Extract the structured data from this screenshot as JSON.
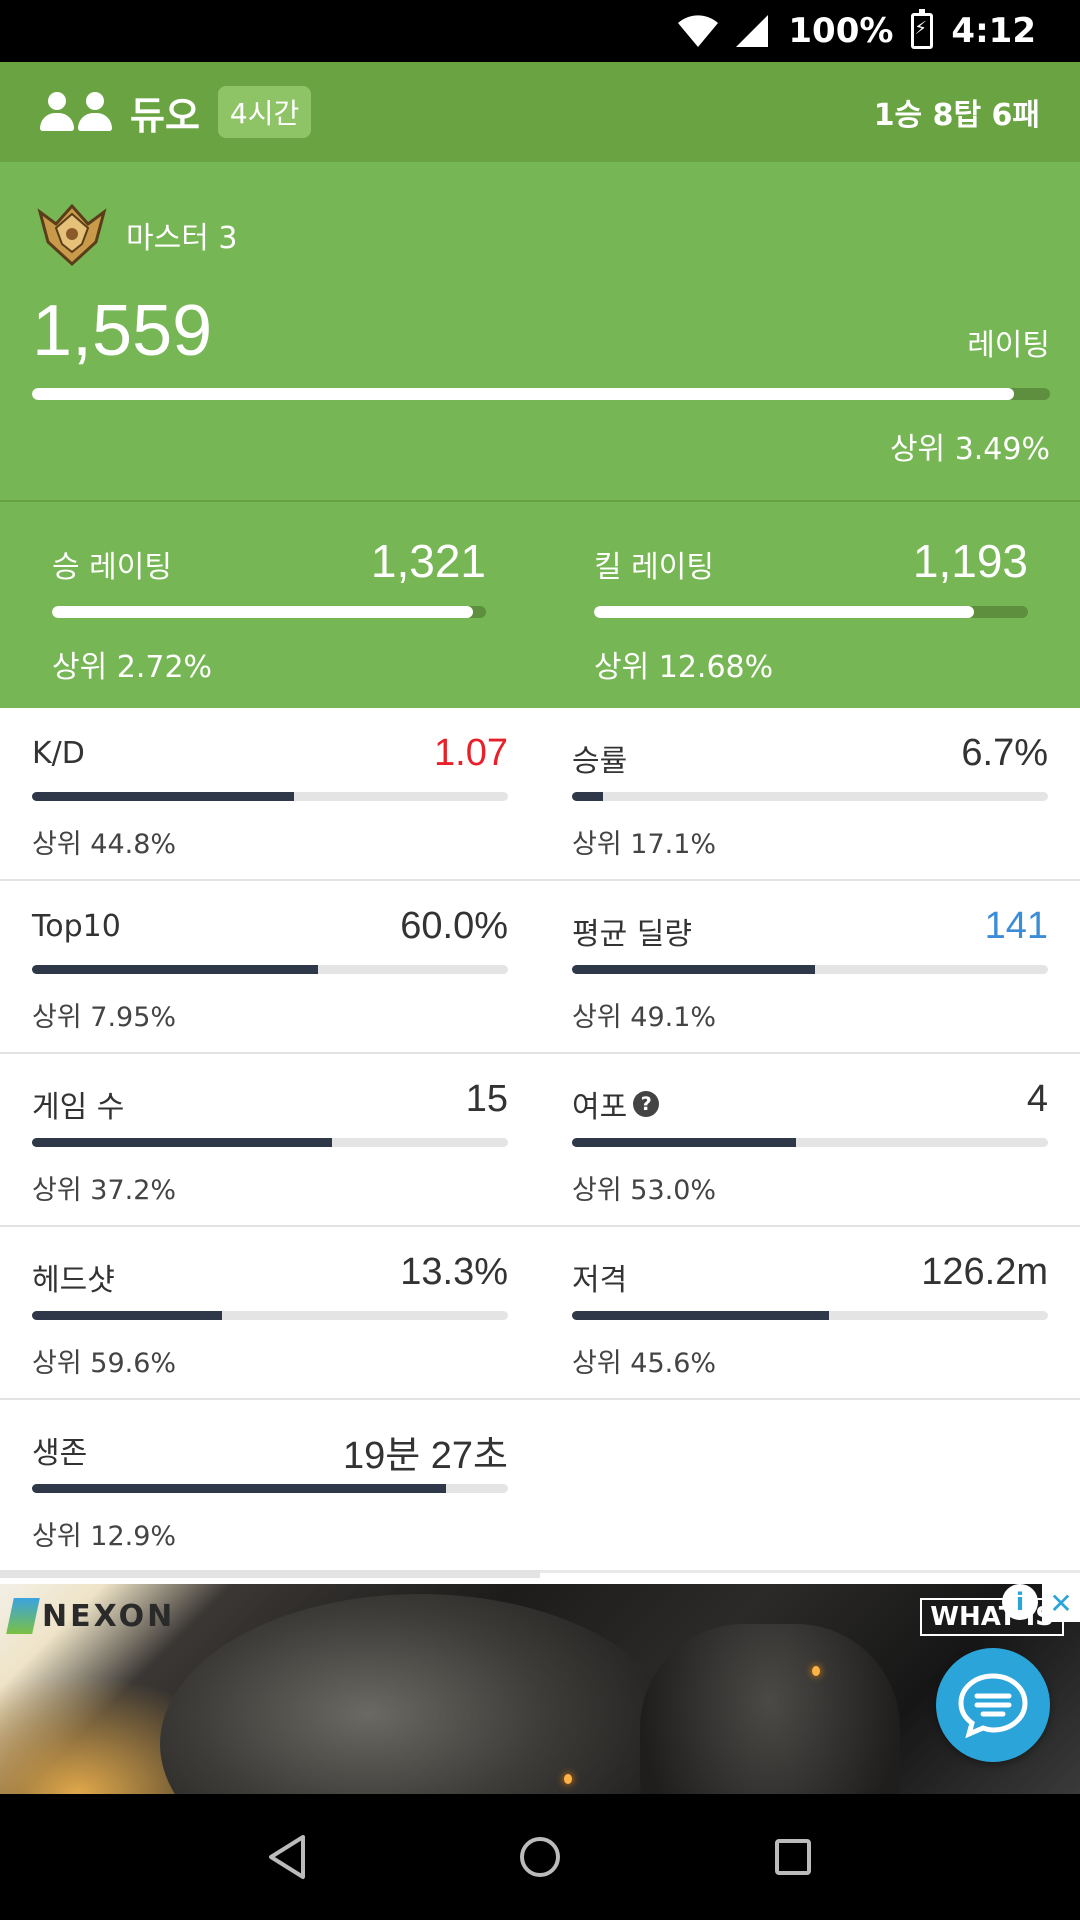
{
  "status_bar": {
    "battery": "100%",
    "time": "4:12"
  },
  "mode": {
    "title": "듀오",
    "badge": "4시간",
    "record": "1승 8탑 6패"
  },
  "rating": {
    "tier": "마스터 3",
    "value": "1,559",
    "label": "레이팅",
    "percentile": "상위 3.49%",
    "bar_fill": 0.965
  },
  "sub_ratings": [
    {
      "name": "승 레이팅",
      "value": "1,321",
      "percentile": "상위 2.72%",
      "bar_fill": 0.97
    },
    {
      "name": "킬 레이팅",
      "value": "1,193",
      "percentile": "상위 12.68%",
      "bar_fill": 0.875
    }
  ],
  "stats": [
    {
      "name": "K/D",
      "value": "1.07",
      "percentile": "상위 44.8%",
      "bar_fill": 0.55,
      "value_color": "#e8202a"
    },
    {
      "name": "승률",
      "value": "6.7%",
      "percentile": "상위 17.1%",
      "bar_fill": 0.065,
      "value_color": "#333333"
    },
    {
      "name": "Top10",
      "value": "60.0%",
      "percentile": "상위 7.95%",
      "bar_fill": 0.6,
      "value_color": "#333333"
    },
    {
      "name": "평균 딜량",
      "value": "141",
      "percentile": "상위 49.1%",
      "bar_fill": 0.51,
      "value_color": "#3c8dd8"
    },
    {
      "name": "게임 수",
      "value": "15",
      "percentile": "상위 37.2%",
      "bar_fill": 0.63,
      "value_color": "#333333"
    },
    {
      "name": "여포",
      "value": "4",
      "percentile": "상위 53.0%",
      "bar_fill": 0.47,
      "value_color": "#333333",
      "help": "?"
    },
    {
      "name": "헤드샷",
      "value": "13.3%",
      "percentile": "상위 59.6%",
      "bar_fill": 0.4,
      "value_color": "#333333"
    },
    {
      "name": "저격",
      "value": "126.2m",
      "percentile": "상위 45.6%",
      "bar_fill": 0.54,
      "value_color": "#333333"
    },
    {
      "name": "생존",
      "value": "19분 27초",
      "percentile": "상위 12.9%",
      "bar_fill": 0.87,
      "value_color": "#333333"
    }
  ],
  "ad": {
    "brand": "NEXON",
    "tag": "WHAT IS",
    "info": "i",
    "close": "✕"
  },
  "colors": {
    "header_green": "#6aa341",
    "rating_green": "#77b654",
    "bar_dark": "#2e3849",
    "kd_red": "#e8202a",
    "damage_blue": "#3c8dd8",
    "fab_blue": "#2aa4d9"
  },
  "icons": [
    "wifi-icon",
    "signal-icon",
    "battery-icon",
    "duo-icon",
    "master-tier-icon",
    "help-icon",
    "chat-icon",
    "back-icon",
    "home-icon",
    "recents-icon"
  ]
}
